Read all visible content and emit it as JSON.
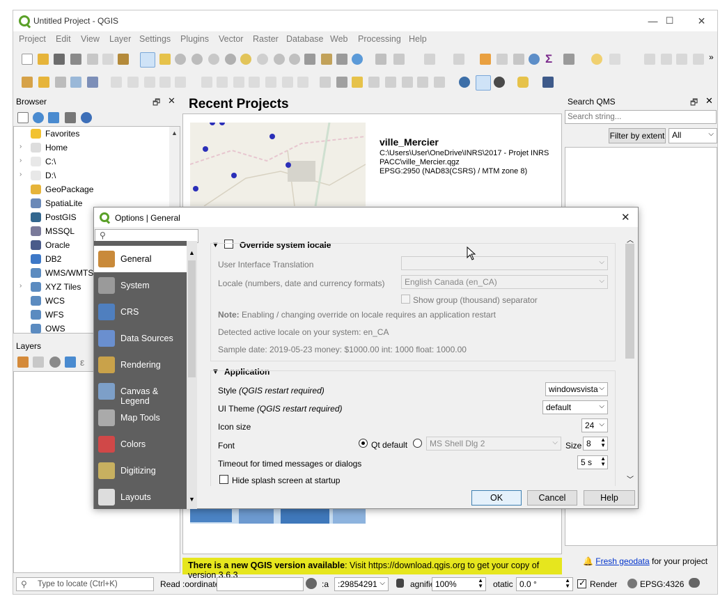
{
  "window": {
    "title": "Untitled Project - QGIS",
    "min": "—",
    "max": "☐",
    "close": "✕"
  },
  "menubar": [
    "Project",
    "Edit",
    "View",
    "Layer",
    "Settings",
    "Plugins",
    "Vector",
    "Raster",
    "Database",
    "Web",
    "Processing",
    "Help"
  ],
  "browser": {
    "title": "Browser",
    "items": [
      {
        "label": "Favorites",
        "arrow": "",
        "icon": "star-icon",
        "color": "#f2c230"
      },
      {
        "label": "Home",
        "arrow": "›",
        "icon": "home-icon",
        "color": "#dddddd"
      },
      {
        "label": "C:\\",
        "arrow": "›",
        "icon": "folder-icon",
        "color": "#e8e8e8"
      },
      {
        "label": "D:\\",
        "arrow": "›",
        "icon": "folder-icon",
        "color": "#e8e8e8"
      },
      {
        "label": "GeoPackage",
        "arrow": "",
        "icon": "geopackage-icon",
        "color": "#e6b43a"
      },
      {
        "label": "SpatiaLite",
        "arrow": "",
        "icon": "feather-icon",
        "color": "#6a89b8"
      },
      {
        "label": "PostGIS",
        "arrow": "",
        "icon": "elephant-icon",
        "color": "#33678f"
      },
      {
        "label": "MSSQL",
        "arrow": "",
        "icon": "mssql-icon",
        "color": "#7a7a9a"
      },
      {
        "label": "Oracle",
        "arrow": "",
        "icon": "oracle-icon",
        "color": "#4a5b8a"
      },
      {
        "label": "DB2",
        "arrow": "",
        "icon": "db2-icon",
        "color": "#3d78c7"
      },
      {
        "label": "WMS/WMTS",
        "arrow": "",
        "icon": "globe-icon",
        "color": "#5b8bc0"
      },
      {
        "label": "XYZ Tiles",
        "arrow": "›",
        "icon": "globe-icon",
        "color": "#5b8bc0"
      },
      {
        "label": "WCS",
        "arrow": "",
        "icon": "globe-icon",
        "color": "#5b8bc0"
      },
      {
        "label": "WFS",
        "arrow": "",
        "icon": "globe-icon",
        "color": "#5b8bc0"
      },
      {
        "label": "OWS",
        "arrow": "",
        "icon": "globe-icon",
        "color": "#5b8bc0"
      }
    ]
  },
  "layers": {
    "title": "Layers"
  },
  "recent": {
    "heading": "Recent Projects",
    "project_name": "ville_Mercier",
    "project_path": "C:\\Users\\User\\OneDrive\\INRS\\2017 - Projet INRS PACC\\ville_Mercier.qgz",
    "project_crs": "EPSG:2950 (NAD83(CSRS) / MTM zone 8)",
    "banner_bold": "There is a new QGIS version available",
    "banner_rest": ": Visit https://download.qgis.org to get your copy of version 3.6.3"
  },
  "qms": {
    "title": "Search QMS",
    "search_placeholder": "Search string...",
    "filter_button": "Filter by extent",
    "filter_value": "All",
    "fresh_link": "Fresh geodata",
    "fresh_rest": " for your project"
  },
  "dialog": {
    "title": "Options | General",
    "search_icon": "magnifier-icon",
    "sidebar": [
      {
        "label": "General",
        "icon": "tools-icon",
        "color": "#c98a3a",
        "selected": true
      },
      {
        "label": "System",
        "icon": "gears-icon",
        "color": "#9a9a9a"
      },
      {
        "label": "CRS",
        "icon": "globe-icon",
        "color": "#4f7fbf"
      },
      {
        "label": "Data Sources",
        "icon": "table-icon",
        "color": "#6a8fcf"
      },
      {
        "label": "Rendering",
        "icon": "brush-icon",
        "color": "#c9a24a"
      },
      {
        "label": "Canvas & Legend",
        "icon": "canvas-icon",
        "color": "#7d9fc8"
      },
      {
        "label": "Map Tools",
        "icon": "maptools-icon",
        "color": "#aaaaaa"
      },
      {
        "label": "Colors",
        "icon": "colors-icon",
        "color": "#d04848"
      },
      {
        "label": "Digitizing",
        "icon": "digitizing-icon",
        "color": "#c7b060"
      },
      {
        "label": "Layouts",
        "icon": "layouts-icon",
        "color": "#dddddd"
      }
    ],
    "locale_group": {
      "title": "Override system locale",
      "ui_translation_label": "User Interface Translation",
      "ui_translation_value": "",
      "locale_label": "Locale (numbers, date and currency formats)",
      "locale_value": "English Canada (en_CA)",
      "show_group_sep": "Show group (thousand) separator",
      "note_bold": "Note:",
      "note_text": " Enabling / changing override on locale requires an application restart",
      "detected": "Detected active locale on your system: en_CA",
      "sample": "Sample date: 2019-05-23 money: $1000.00 int: 1000 float: 1000.00"
    },
    "app_group": {
      "title": "Application",
      "style_label": "Style",
      "style_note": "(QGIS restart required)",
      "style_value": "windowsvista",
      "theme_label": "UI Theme",
      "theme_note": "(QGIS restart required)",
      "theme_value": "default",
      "icon_size_label": "Icon size",
      "icon_size_value": "24",
      "font_label": "Font",
      "font_qt_default": "Qt default",
      "font_family": "MS Shell Dlg 2",
      "font_size_label": "Size",
      "font_size_value": "8",
      "timeout_label": "Timeout for timed messages or dialogs",
      "timeout_value": "5 s",
      "hide_splash": "Hide splash screen at startup"
    },
    "buttons": {
      "ok": "OK",
      "cancel": "Cancel",
      "help": "Help"
    }
  },
  "statusbar": {
    "locate_placeholder": "Type to locate (Ctrl+K)",
    "read": "Read",
    "coordinate_label": ":oordinate",
    "coordinate_value": "",
    "scale_label": ":a",
    "scale_value": ":29854291",
    "magnifier_label": "agnifie",
    "magnifier_value": "100%",
    "rotation_label": "otatic",
    "rotation_value": "0.0 °",
    "render": "Render",
    "crs": "EPSG:4326"
  }
}
